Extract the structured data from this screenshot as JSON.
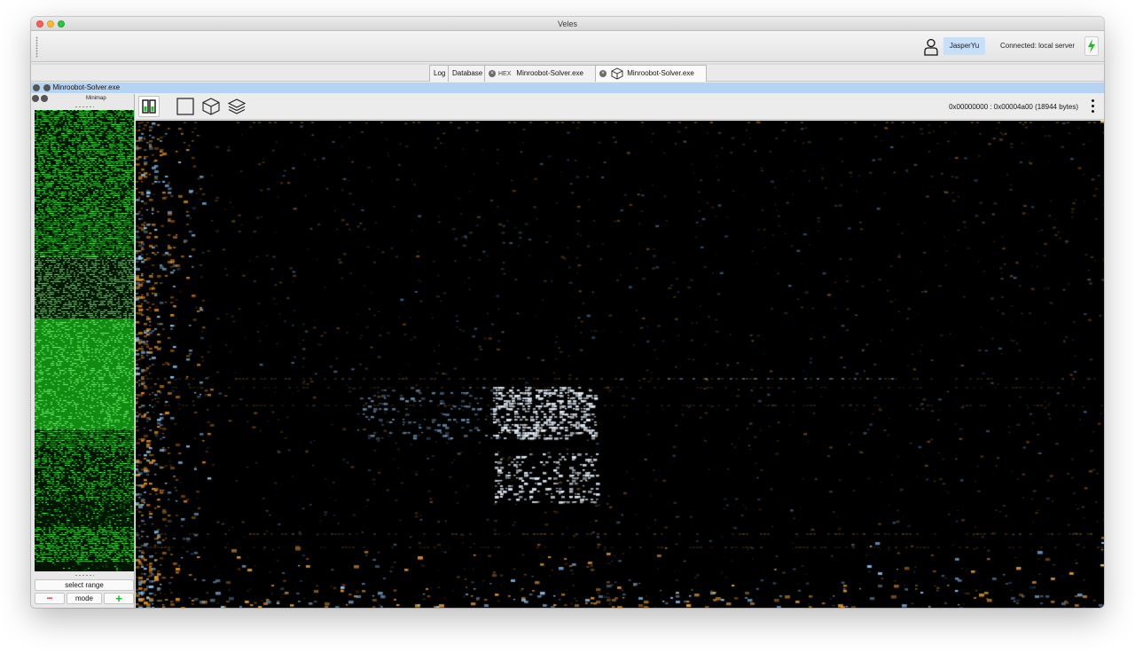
{
  "window": {
    "title": "Veles"
  },
  "toolbar": {
    "user_name": "JasperYu",
    "connection_status": "Connected: local server",
    "user_icon": "person-icon",
    "connection_icon": "lightning-bolt-icon"
  },
  "tabs": [
    {
      "label": "Log"
    },
    {
      "label": "Database"
    },
    {
      "prefix": "HEX",
      "label": "Minroobot-Solver.exe",
      "icon": "close-icon"
    },
    {
      "label": "Minroobot-Solver.exe",
      "icon": "cube-icon",
      "active": true
    }
  ],
  "filebar": {
    "file_name": "Minroobot-Solver.exe"
  },
  "minimap": {
    "title": "Minimap",
    "select_range_label": "select range",
    "mode_label": "mode",
    "minus_label": "−",
    "plus_label": "+"
  },
  "view": {
    "range_label": "0x00000000 : 0x00004a00 (18944 bytes)",
    "tools": [
      "panels-toggle-icon",
      "square-icon",
      "cube-icon",
      "layers-icon"
    ]
  },
  "colors": {
    "selection": "#b5d4f4",
    "user_button": "#c7dff7",
    "minimap_green": "#1fae1f",
    "visual_orange": "#f0a030",
    "visual_blue": "#7fc6ff"
  }
}
